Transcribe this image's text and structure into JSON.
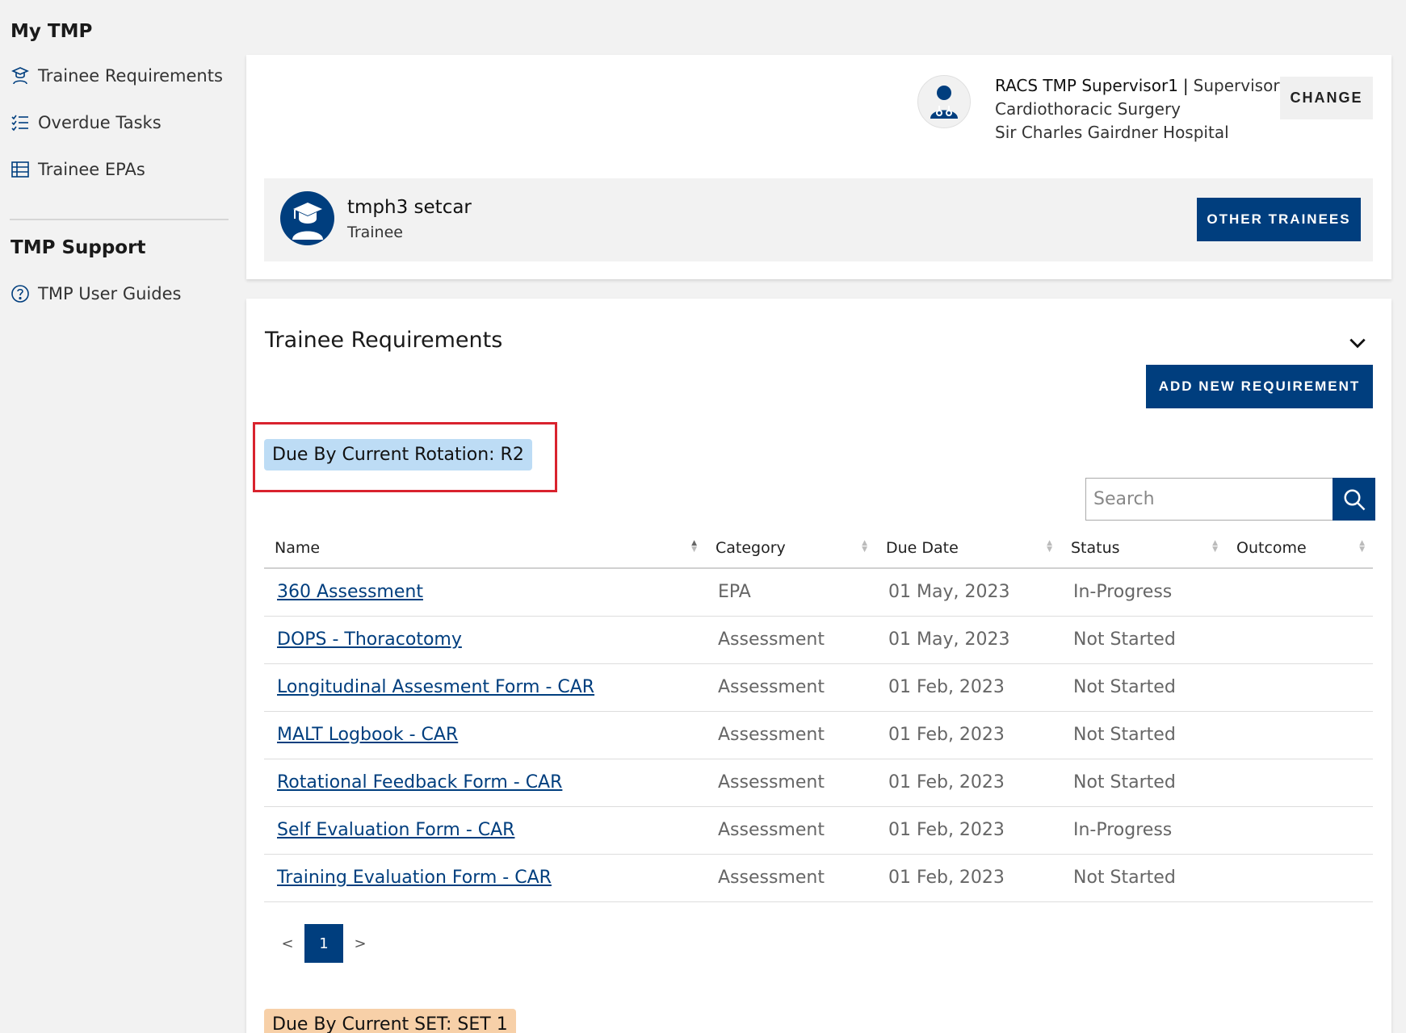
{
  "sidebar": {
    "section1_title": "My TMP",
    "items": [
      {
        "label": "Trainee Requirements",
        "icon": "trainee-icon"
      },
      {
        "label": "Overdue Tasks",
        "icon": "checklist-icon"
      },
      {
        "label": "Trainee EPAs",
        "icon": "table-icon"
      }
    ],
    "section2_title": "TMP Support",
    "support_items": [
      {
        "label": "TMP User Guides",
        "icon": "help-circle-icon"
      }
    ]
  },
  "user": {
    "name": "RACS TMP Supervisor1",
    "separator": "|",
    "role": "Supervisor",
    "specialty": "Cardiothoracic Surgery",
    "hospital": "Sir Charles Gairdner Hospital",
    "change_label": "CHANGE"
  },
  "trainee": {
    "name": "tmph3 setcar",
    "role": "Trainee",
    "other_label": "OTHER TRAINEES"
  },
  "requirements": {
    "title": "Trainee Requirements",
    "add_label": "ADD NEW REQUIREMENT",
    "rotation_badge": "Due By Current Rotation:  R2",
    "set_badge": "Due By Current SET:  SET 1",
    "search_placeholder": "Search",
    "columns": [
      "Name",
      "Category",
      "Due Date",
      "Status",
      "Outcome"
    ],
    "rows": [
      {
        "name": "360 Assessment",
        "category": "EPA",
        "due": "01 May, 2023",
        "status": "In-Progress",
        "outcome": ""
      },
      {
        "name": "DOPS - Thoracotomy",
        "category": "Assessment",
        "due": "01 May, 2023",
        "status": "Not Started",
        "outcome": ""
      },
      {
        "name": "Longitudinal Assesment Form - CAR",
        "category": "Assessment",
        "due": "01 Feb, 2023",
        "status": "Not Started",
        "outcome": ""
      },
      {
        "name": "MALT Logbook - CAR",
        "category": "Assessment",
        "due": "01 Feb, 2023",
        "status": "Not Started",
        "outcome": ""
      },
      {
        "name": "Rotational Feedback Form - CAR",
        "category": "Assessment",
        "due": "01 Feb, 2023",
        "status": "Not Started",
        "outcome": ""
      },
      {
        "name": "Self Evaluation Form - CAR",
        "category": "Assessment",
        "due": "01 Feb, 2023",
        "status": "In-Progress",
        "outcome": ""
      },
      {
        "name": "Training Evaluation Form - CAR",
        "category": "Assessment",
        "due": "01 Feb, 2023",
        "status": "Not Started",
        "outcome": ""
      }
    ],
    "pager": {
      "prev": "<",
      "current": "1",
      "next": ">"
    }
  },
  "colors": {
    "primary": "#003e7e",
    "rotation_badge": "#bddcf5",
    "set_badge": "#f7d0a8",
    "highlight": "#d9232e"
  }
}
